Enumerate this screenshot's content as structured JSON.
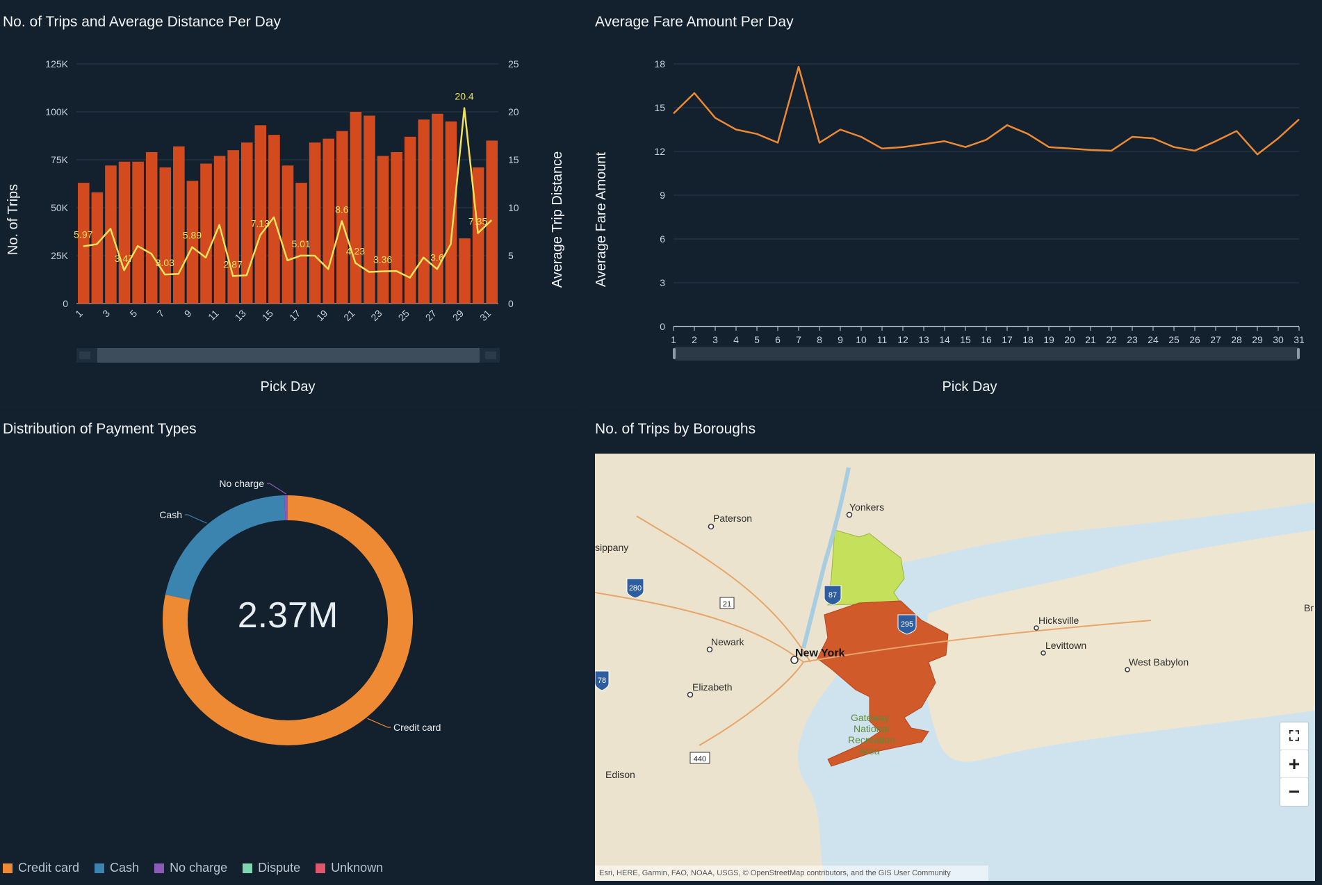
{
  "panels": {
    "trips": {
      "title": "No. of Trips and Average Distance Per Day"
    },
    "fare": {
      "title": "Average Fare Amount Per Day"
    },
    "payment": {
      "title": "Distribution of Payment Types"
    },
    "boroughs": {
      "title": "No. of Trips by Boroughs"
    }
  },
  "colors": {
    "bar": "#d44a1f",
    "line_yellow": "#f2e15c",
    "fare_line": "#ee8a33",
    "credit": "#ee8a33",
    "cash": "#3b84b0",
    "no_charge": "#8e5ab8",
    "dispute": "#7fd6b0",
    "unknown": "#e0576b"
  },
  "chart_data": [
    {
      "type": "bar",
      "title": "No. of Trips and Average Distance Per Day",
      "xlabel": "Pick Day",
      "ylabel": "No. of Trips",
      "y2label": "Average Trip Distance",
      "categories": [
        1,
        2,
        3,
        4,
        5,
        6,
        7,
        8,
        9,
        10,
        11,
        12,
        13,
        14,
        15,
        16,
        17,
        18,
        19,
        20,
        21,
        22,
        23,
        24,
        25,
        26,
        27,
        28,
        29,
        30,
        31
      ],
      "xtick_labels": [
        "1",
        "3",
        "5",
        "7",
        "9",
        "11",
        "13",
        "15",
        "17",
        "19",
        "21",
        "23",
        "25",
        "27",
        "29",
        "31"
      ],
      "yticks": [
        "0",
        "25K",
        "50K",
        "75K",
        "100K",
        "125K"
      ],
      "y2ticks": [
        "0",
        "5",
        "10",
        "15",
        "20",
        "25"
      ],
      "ylim": [
        0,
        125000
      ],
      "y2lim": [
        0,
        25
      ],
      "series": [
        {
          "name": "No. of Trips",
          "type": "bar",
          "values": [
            63000,
            58000,
            72000,
            74000,
            74000,
            79000,
            71000,
            82000,
            64000,
            73000,
            77000,
            80000,
            84000,
            93000,
            88000,
            72000,
            63000,
            84000,
            86000,
            90000,
            100000,
            98000,
            77000,
            79000,
            87000,
            96000,
            99000,
            95000,
            34000,
            71000,
            85000
          ]
        },
        {
          "name": "Average Trip Distance",
          "type": "line",
          "axis": "right",
          "values": [
            5.97,
            6.2,
            7.8,
            3.47,
            6.0,
            5.2,
            3.03,
            3.1,
            5.89,
            4.8,
            8.2,
            2.87,
            2.95,
            7.13,
            9.0,
            4.5,
            5.01,
            5.0,
            3.6,
            8.6,
            4.23,
            3.3,
            3.36,
            3.4,
            2.7,
            4.8,
            3.6,
            6.2,
            20.4,
            7.35,
            8.7
          ]
        }
      ],
      "data_labels": [
        {
          "index": 0,
          "text": "5.97"
        },
        {
          "index": 3,
          "text": "3.47"
        },
        {
          "index": 6,
          "text": "3.03"
        },
        {
          "index": 8,
          "text": "5.89"
        },
        {
          "index": 11,
          "text": "2.87"
        },
        {
          "index": 13,
          "text": "7.13"
        },
        {
          "index": 16,
          "text": "5.01"
        },
        {
          "index": 19,
          "text": "8.6"
        },
        {
          "index": 20,
          "text": "4.23"
        },
        {
          "index": 22,
          "text": "3.36"
        },
        {
          "index": 26,
          "text": "3.6"
        },
        {
          "index": 28,
          "text": "20.4"
        },
        {
          "index": 29,
          "text": "7.35"
        }
      ]
    },
    {
      "type": "line",
      "title": "Average Fare Amount Per Day",
      "xlabel": "Pick Day",
      "ylabel": "Average Fare Amount",
      "categories": [
        1,
        2,
        3,
        4,
        5,
        6,
        7,
        8,
        9,
        10,
        11,
        12,
        13,
        14,
        15,
        16,
        17,
        18,
        19,
        20,
        21,
        22,
        23,
        24,
        25,
        26,
        27,
        28,
        29,
        30,
        31
      ],
      "yticks": [
        "0",
        "3",
        "6",
        "9",
        "12",
        "15",
        "18"
      ],
      "ylim": [
        0,
        18
      ],
      "series": [
        {
          "name": "Average Fare Amount",
          "values": [
            14.6,
            16.0,
            14.3,
            13.5,
            13.2,
            12.6,
            17.8,
            12.6,
            13.5,
            13.0,
            12.2,
            12.3,
            12.5,
            12.7,
            12.3,
            12.8,
            13.8,
            13.2,
            12.3,
            12.2,
            12.1,
            12.05,
            13.0,
            12.9,
            12.3,
            12.05,
            12.7,
            13.4,
            11.8,
            12.9,
            14.2
          ]
        }
      ]
    },
    {
      "type": "pie",
      "title": "Distribution of Payment Types",
      "center_label": "2.37M",
      "categories": [
        "Credit card",
        "Cash",
        "No charge",
        "Dispute",
        "Unknown"
      ],
      "values": [
        78.3,
        21.3,
        0.4,
        0.0,
        0.0
      ],
      "legend_position": "bottom-left"
    }
  ],
  "map": {
    "places": [
      {
        "name": "Yonkers"
      },
      {
        "name": "Paterson"
      },
      {
        "name": "sippany"
      },
      {
        "name": "Newark"
      },
      {
        "name": "New York"
      },
      {
        "name": "Elizabeth"
      },
      {
        "name": "Hicksville"
      },
      {
        "name": "Levittown"
      },
      {
        "name": "West Babylon"
      },
      {
        "name": "Edison"
      },
      {
        "name": "Br"
      },
      {
        "name": "Gateway"
      },
      {
        "name": "National"
      },
      {
        "name": "Recreation"
      },
      {
        "name": "Area"
      }
    ],
    "shields": [
      "87",
      "280",
      "295",
      "78"
    ],
    "route_boxes": [
      "21",
      "440"
    ],
    "attribution": "Esri, HERE, Garmin, FAO, NOAA, USGS, © OpenStreetMap contributors, and the GIS User Community",
    "controls": {
      "zoom_in": "+",
      "zoom_out": "−"
    }
  }
}
